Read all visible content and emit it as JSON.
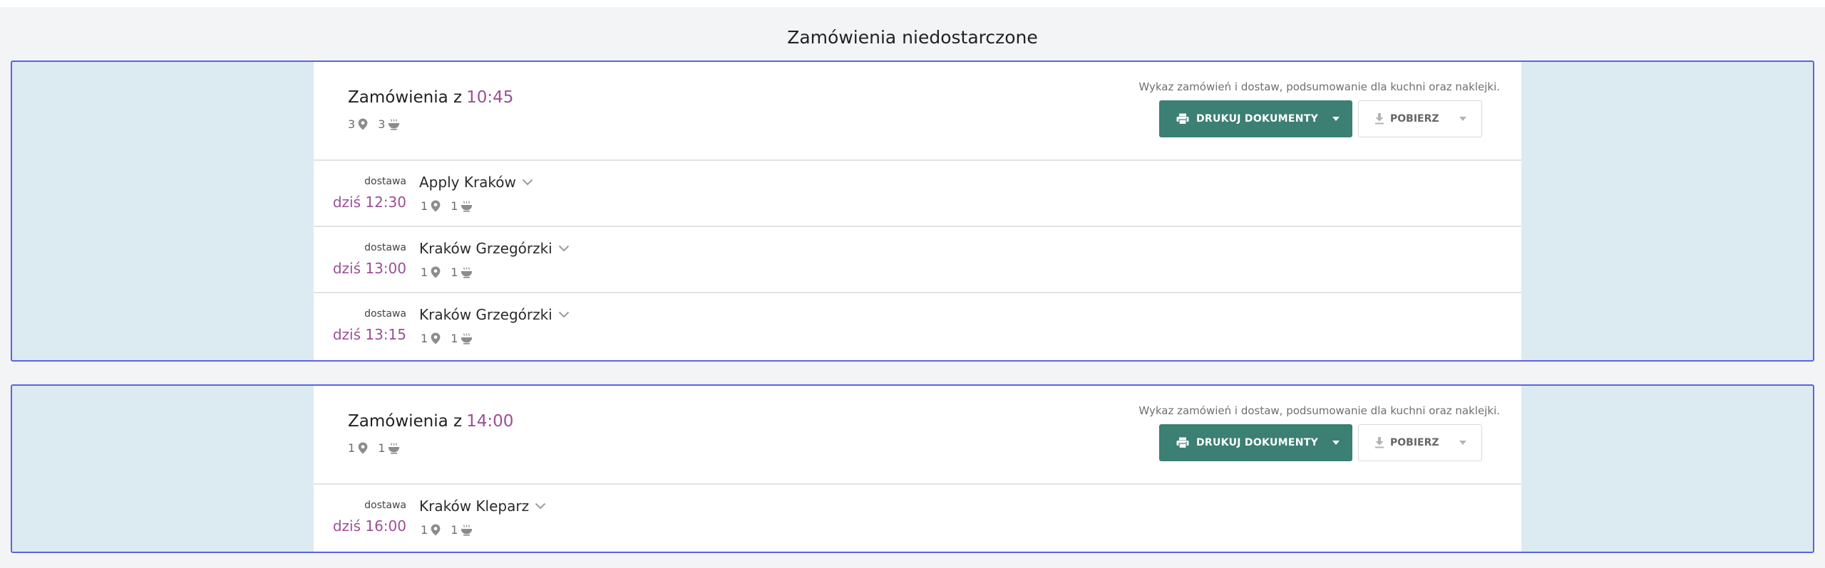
{
  "page": {
    "title": "Zamówienia niedostarczone"
  },
  "groups": [
    {
      "title_prefix": "Zamówienia z",
      "time": "10:45",
      "locations": "3",
      "meals": "3",
      "description": "Wykaz zamówień i dostaw, podsumowanie dla kuchni oraz naklejki.",
      "print_label": "DRUKUJ DOKUMENTY",
      "download_label": "POBIERZ",
      "deliveries": [
        {
          "type": "dostawa",
          "when": "dziś 12:30",
          "name": "Apply Kraków",
          "locations": "1",
          "meals": "1"
        },
        {
          "type": "dostawa",
          "when": "dziś 13:00",
          "name": "Kraków Grzegórzki",
          "locations": "1",
          "meals": "1"
        },
        {
          "type": "dostawa",
          "when": "dziś 13:15",
          "name": "Kraków Grzegórzki",
          "locations": "1",
          "meals": "1"
        }
      ]
    },
    {
      "title_prefix": "Zamówienia z",
      "time": "14:00",
      "locations": "1",
      "meals": "1",
      "description": "Wykaz zamówień i dostaw, podsumowanie dla kuchni oraz naklejki.",
      "print_label": "DRUKUJ DOKUMENTY",
      "download_label": "POBIERZ",
      "deliveries": [
        {
          "type": "dostawa",
          "when": "dziś 16:00",
          "name": "Kraków Kleparz",
          "locations": "1",
          "meals": "1"
        }
      ]
    }
  ],
  "colors": {
    "accent": "#9b4f95",
    "primary_button": "#3c7f73",
    "group_border": "#5b63e0",
    "group_bg": "#dcebf2"
  },
  "icons": {
    "location": "map-pin-icon",
    "meal": "bowl-icon",
    "print": "printer-icon",
    "download": "download-icon",
    "caret": "caret-down-icon",
    "chevron": "chevron-down-icon"
  }
}
